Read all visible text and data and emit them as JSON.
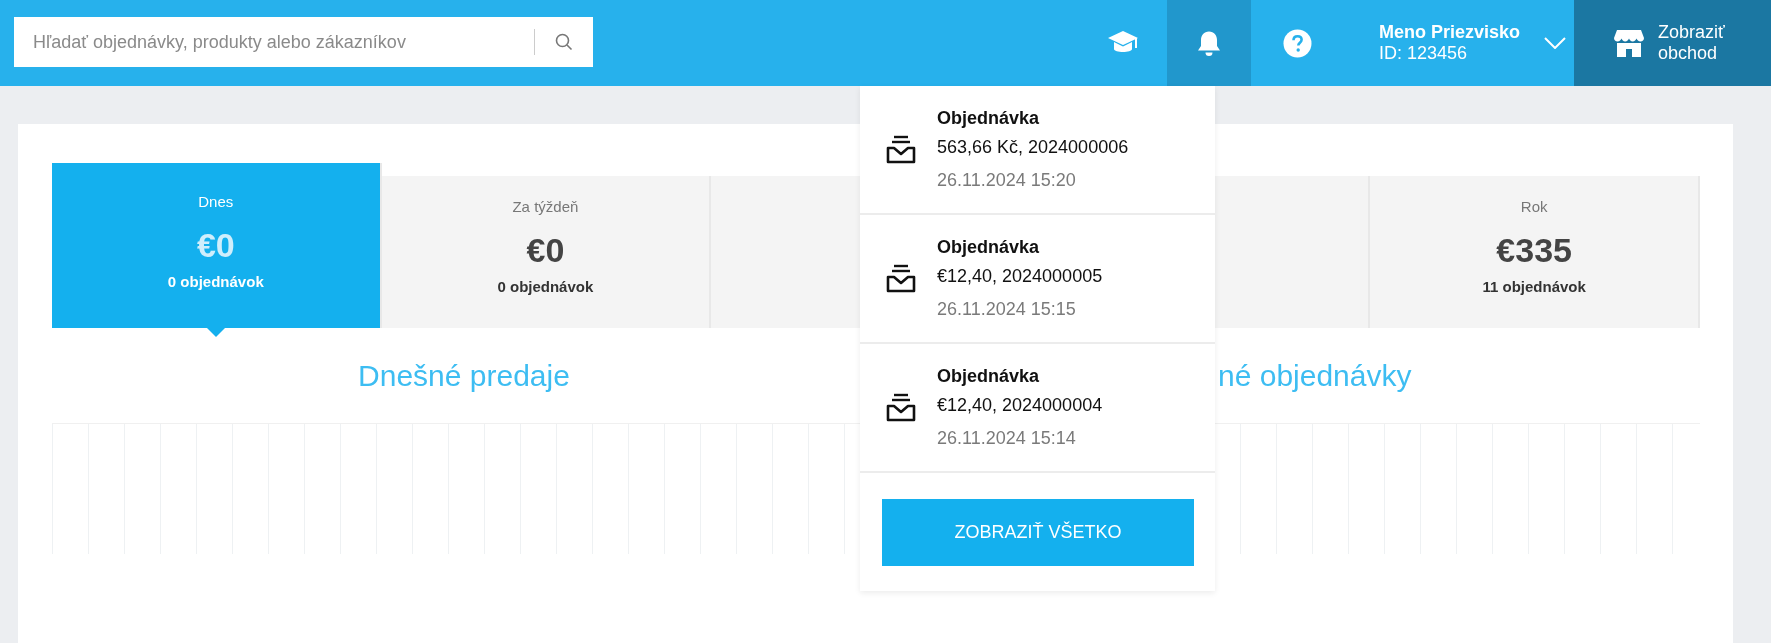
{
  "search": {
    "placeholder": "Hľadať objednávky, produkty alebo zákazníkov"
  },
  "header": {
    "notifications_open": true,
    "user_name": "Meno Priezvisko",
    "user_id": "ID: 123456",
    "store_link": "Zobraziť obchod"
  },
  "stats": [
    {
      "label": "Dnes",
      "value": "€0",
      "count": "0 objednávok",
      "selected": true
    },
    {
      "label": "Za týždeň",
      "value": "€0",
      "count": "0 objednávok",
      "selected": false
    },
    {
      "selected": false
    },
    {
      "selected": false
    },
    {
      "label": "Rok",
      "value": "€335",
      "count": "11 objednávok",
      "selected": false
    }
  ],
  "charts": [
    {
      "title": "Dnešné predaje"
    },
    {
      "title": "né objednávky"
    }
  ],
  "notifications": [
    {
      "title": "Objednávka",
      "detail": "563,66 Kč, 2024000006",
      "time": "26.11.2024 15:20"
    },
    {
      "title": "Objednávka",
      "detail": "€12,40, 2024000005",
      "time": "26.11.2024 15:15"
    },
    {
      "title": "Objednávka",
      "detail": "€12,40, 2024000004",
      "time": "26.11.2024 15:14"
    }
  ],
  "notifications_button": "ZOBRAZIŤ VŠETKO"
}
